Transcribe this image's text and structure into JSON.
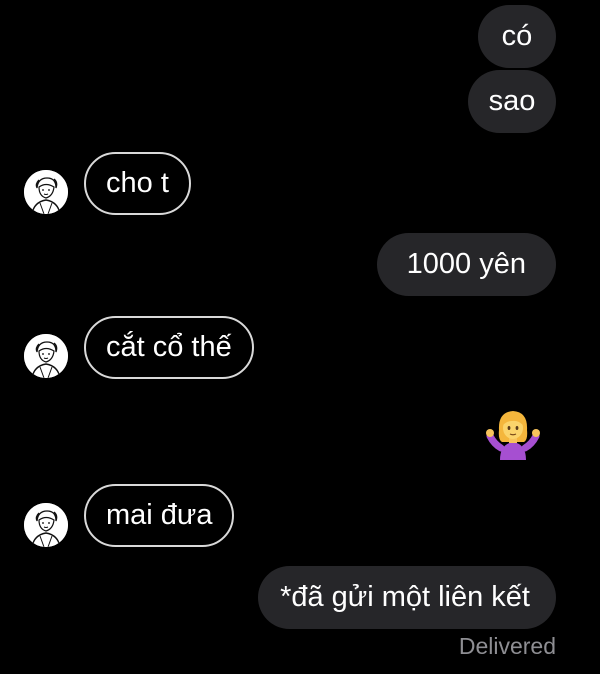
{
  "messages": [
    {
      "direction": "sent",
      "text": "có"
    },
    {
      "direction": "sent",
      "text": "sao"
    },
    {
      "direction": "received",
      "text": "cho t"
    },
    {
      "direction": "sent",
      "text": "1000 yên"
    },
    {
      "direction": "received",
      "text": "cắt cổ thế"
    },
    {
      "direction": "sent",
      "emoji": "woman-shrugging-icon"
    },
    {
      "direction": "received",
      "text": "mai đưa"
    },
    {
      "direction": "sent",
      "text": "*đã gửi một liên kết"
    }
  ],
  "status": {
    "delivered_label": "Delivered"
  },
  "colors": {
    "background": "#000000",
    "sent_bubble": "#262629",
    "received_border": "#d9d9d9",
    "text": "#ffffff",
    "status_text": "#8e8e93"
  }
}
